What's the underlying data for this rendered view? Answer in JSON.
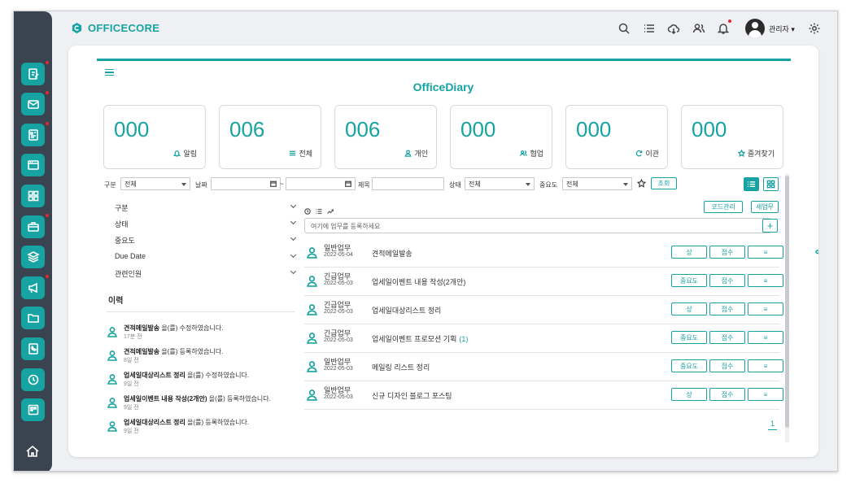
{
  "app": {
    "name": "OFFICECORE",
    "page_title": "OfficeDiary",
    "user": "관리자 ▾"
  },
  "header_icons": [
    "search-icon",
    "list-icon",
    "cloud-download-icon",
    "users-icon",
    "bell-icon",
    "gear-icon"
  ],
  "sidebar": {
    "icons": [
      "edit-doc-icon",
      "mail-icon",
      "calendar-doc-icon",
      "window-icon",
      "grid-icon",
      "briefcase-icon",
      "layers-icon",
      "megaphone-icon",
      "folder-icon",
      "phone-book-icon",
      "clock-icon",
      "board-icon"
    ],
    "home": "home-icon"
  },
  "stats": [
    {
      "value": "000",
      "label": "알림",
      "icon": "bell-icon"
    },
    {
      "value": "006",
      "label": "전체",
      "icon": "list-icon"
    },
    {
      "value": "006",
      "label": "개인",
      "icon": "user-icon"
    },
    {
      "value": "000",
      "label": "협업",
      "icon": "users-icon"
    },
    {
      "value": "000",
      "label": "이관",
      "icon": "refresh-icon"
    },
    {
      "value": "000",
      "label": "즐겨찾기",
      "icon": "star-icon"
    }
  ],
  "filters": {
    "category_label": "구분",
    "category_value": "전체",
    "date_label": "날짜",
    "date_sep": "~",
    "title_label": "제목",
    "status_label": "상태",
    "status_value": "전체",
    "priority_label": "중요도",
    "priority_value": "전체",
    "search_button": "조회"
  },
  "accordion": [
    "구분",
    "상태",
    "중요도",
    "Due Date",
    "관련인원"
  ],
  "history": {
    "title": "이력",
    "items": [
      {
        "title": "견적메일발송",
        "action": "을(를) 수정하였습니다.",
        "time": "17분 전"
      },
      {
        "title": "견적메일발송",
        "action": "을(를) 등록하였습니다.",
        "time": "8일 전"
      },
      {
        "title": "업세일대상리스트 정리",
        "action": "을(를) 수정하였습니다.",
        "time": "9일 전"
      },
      {
        "title": "업세일이벤트 내용 작성(2개안)",
        "action": "을(를) 등록하였습니다.",
        "time": "9일 전"
      },
      {
        "title": "업세일대상리스트 정리",
        "action": "을(를) 등록하였습니다.",
        "time": "9일 전"
      }
    ]
  },
  "task_panel": {
    "code_button": "코드관리",
    "new_button": "새업무",
    "input_placeholder": "여기에 업무를 등록하세요",
    "add_button": "+",
    "tasks": [
      {
        "type": "일반업무",
        "date": "2022-05-04",
        "title": "견적메일발송",
        "count": "",
        "priority": "상",
        "status": "접수",
        "menu": "≡",
        "has_link": true
      },
      {
        "type": "긴급업무",
        "date": "2022-05-03",
        "title": "업세일이벤트 내용 작성(2개안)",
        "count": "",
        "priority": "중요도",
        "status": "접수",
        "menu": "≡",
        "has_link": false
      },
      {
        "type": "긴급업무",
        "date": "2022-05-03",
        "title": "업세일대상리스트 정리",
        "count": "",
        "priority": "상",
        "status": "접수",
        "menu": "≡",
        "has_link": false
      },
      {
        "type": "긴급업무",
        "date": "2022-05-03",
        "title": "업세일이벤트 프로모션 기획",
        "count": "(1)",
        "priority": "중요도",
        "status": "접수",
        "menu": "≡",
        "has_link": false
      },
      {
        "type": "일반업무",
        "date": "2022-05-03",
        "title": "메일링 리스트 정리",
        "count": "",
        "priority": "중요도",
        "status": "접수",
        "menu": "≡",
        "has_link": false
      },
      {
        "type": "일반업무",
        "date": "2022-05-03",
        "title": "신규 디자인 블로그 포스팅",
        "count": "",
        "priority": "상",
        "status": "접수",
        "menu": "≡",
        "has_link": false
      }
    ],
    "page": "1"
  },
  "colors": {
    "accent": "#17a3a1",
    "sidebar": "#3a4350",
    "alert": "#e02b2b"
  }
}
